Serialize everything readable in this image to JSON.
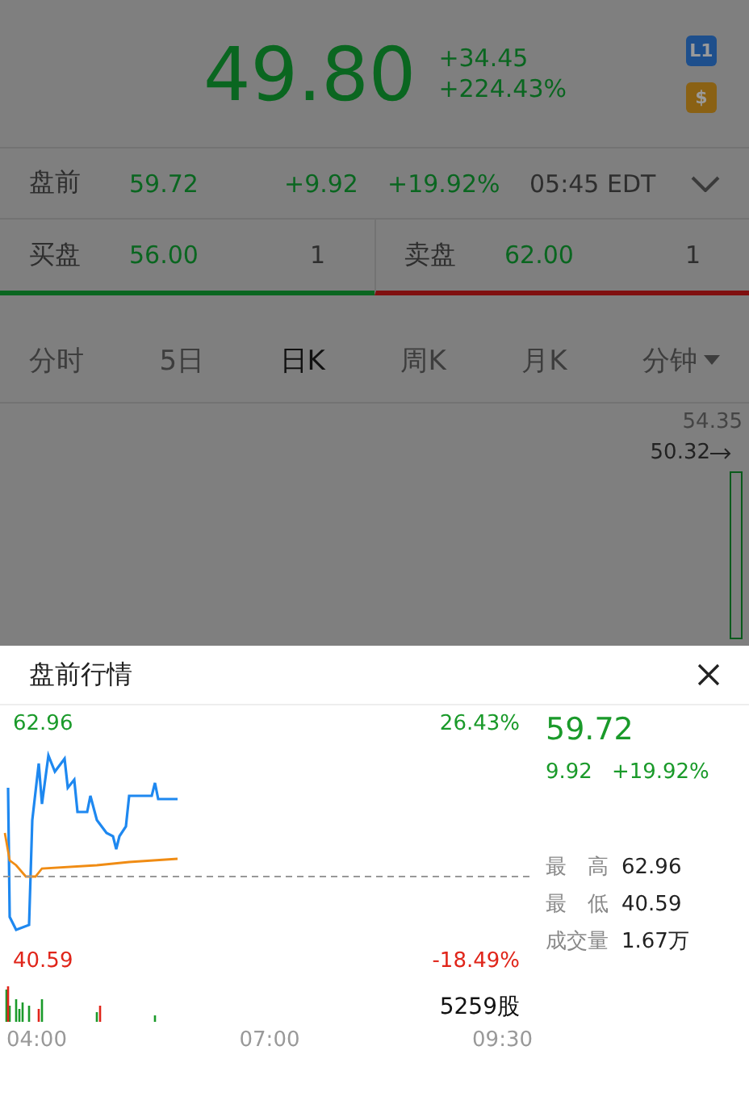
{
  "quote": {
    "price": "49.80",
    "change": "+34.45",
    "change_pct": "+224.43%",
    "badges": [
      {
        "kind": "level",
        "text": "L1"
      },
      {
        "kind": "currency",
        "text": "$"
      }
    ]
  },
  "premarket_row": {
    "label": "盘前",
    "price": "59.72",
    "change": "+9.92",
    "change_pct": "+19.92%",
    "time": "05:45 EDT"
  },
  "bid": {
    "label": "买盘",
    "price": "56.00",
    "size": "1"
  },
  "ask": {
    "label": "卖盘",
    "price": "62.00",
    "size": "1"
  },
  "tabs": [
    {
      "label": "分时",
      "selected": false,
      "dropdown": false
    },
    {
      "label": "5日",
      "selected": false,
      "dropdown": false
    },
    {
      "label": "日K",
      "selected": true,
      "dropdown": false
    },
    {
      "label": "周K",
      "selected": false,
      "dropdown": false
    },
    {
      "label": "月K",
      "selected": false,
      "dropdown": false
    },
    {
      "label": "分钟",
      "selected": false,
      "dropdown": true
    }
  ],
  "kline": {
    "high_label": "54.35",
    "last_label": "50.32"
  },
  "sheet": {
    "title": "盘前行情",
    "chart": {
      "high": "62.96",
      "high_pct": "26.43%",
      "low": "40.59",
      "low_pct": "-18.49%",
      "volume": "5259股",
      "times": [
        "04:00",
        "07:00",
        "09:30"
      ]
    },
    "price": "59.72",
    "change": "9.92",
    "change_pct": "+19.92%",
    "stats": [
      {
        "label": "最　高",
        "value": "62.96"
      },
      {
        "label": "最　低",
        "value": "40.59"
      },
      {
        "label": "成交量",
        "value": "1.67万"
      }
    ]
  }
}
